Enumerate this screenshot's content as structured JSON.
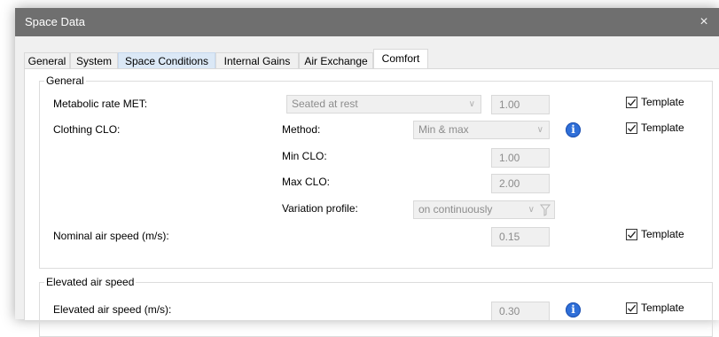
{
  "window": {
    "title": "Space Data",
    "close_glyph": "×"
  },
  "tabs": [
    {
      "label": "General"
    },
    {
      "label": "System"
    },
    {
      "label": "Space Conditions"
    },
    {
      "label": "Internal Gains"
    },
    {
      "label": "Air Exchange"
    },
    {
      "label": "Comfort"
    }
  ],
  "active_tab": "Comfort",
  "general_group": {
    "title": "General",
    "metabolic": {
      "label": "Metabolic rate MET:",
      "select_value": "Seated at rest",
      "value": "1.00",
      "template_label": "Template",
      "template_checked": true
    },
    "clothing": {
      "label": "Clothing CLO:",
      "method_label": "Method:",
      "method_value": "Min & max",
      "min_label": "Min CLO:",
      "min_value": "1.00",
      "max_label": "Max CLO:",
      "max_value": "2.00",
      "profile_label": "Variation profile:",
      "profile_value": "on continuously",
      "template_label": "Template",
      "template_checked": true
    },
    "nominal_air_speed": {
      "label": "Nominal air speed (m/s):",
      "value": "0.15",
      "template_label": "Template",
      "template_checked": true
    }
  },
  "elevated_group": {
    "title": "Elevated air speed",
    "elevated_air_speed": {
      "label": "Elevated air speed (m/s):",
      "value": "0.30",
      "template_label": "Template",
      "template_checked": true
    }
  },
  "icons": {
    "info": "info-icon",
    "filter": "filter-icon",
    "chevron": "chevron-down-icon"
  }
}
